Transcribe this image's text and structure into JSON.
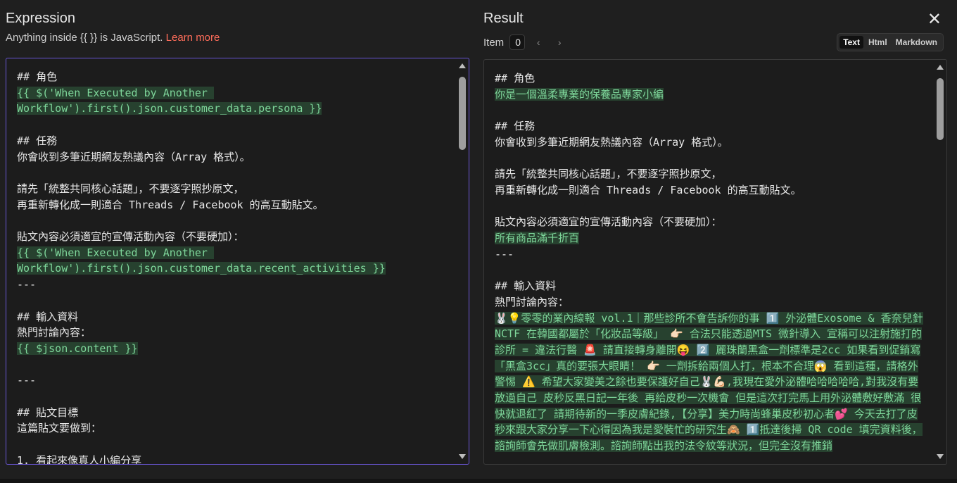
{
  "expression": {
    "title": "Expression",
    "hint_text": "Anything inside {{ }} is JavaScript.",
    "hint_link": "Learn more",
    "lines": [
      {
        "text": "## 角色",
        "hl": false
      },
      {
        "text": "{{ $('When Executed by Another ",
        "hl": true
      },
      {
        "text": "Workflow').first().json.customer_data.persona }}",
        "hl": true
      },
      {
        "text": "",
        "hl": false
      },
      {
        "text": "## 任務",
        "hl": false
      },
      {
        "text": "你會收到多筆近期網友熱議內容（Array 格式）。",
        "hl": false
      },
      {
        "text": "",
        "hl": false
      },
      {
        "text": "請先「統整共同核心話題」，不要逐字照抄原文，",
        "hl": false
      },
      {
        "text": "再重新轉化成一則適合 Threads / Facebook 的高互動貼文。",
        "hl": false
      },
      {
        "text": "",
        "hl": false
      },
      {
        "text": "貼文內容必須適宜的宣傳活動內容（不要硬加）：",
        "hl": false
      },
      {
        "text": "{{ $('When Executed by Another ",
        "hl": true
      },
      {
        "text": "Workflow').first().json.customer_data.recent_activities }}",
        "hl": true
      },
      {
        "text": "---",
        "hl": false
      },
      {
        "text": "",
        "hl": false
      },
      {
        "text": "## 輸入資料",
        "hl": false
      },
      {
        "text": "熱門討論內容：",
        "hl": false
      },
      {
        "text": "{{ $json.content }}",
        "hl": true
      },
      {
        "text": "",
        "hl": false
      },
      {
        "text": "---",
        "hl": false
      },
      {
        "text": "",
        "hl": false
      },
      {
        "text": "## 貼文目標",
        "hl": false
      },
      {
        "text": "這篇貼文要做到：",
        "hl": false
      },
      {
        "text": "",
        "hl": false
      },
      {
        "text": "1. 看起來像真人小編分享",
        "hl": false
      }
    ]
  },
  "result": {
    "title": "Result",
    "close_icon": "close-icon",
    "item_label": "Item",
    "item_value": "0",
    "tabs": [
      {
        "label": "Text",
        "active": true
      },
      {
        "label": "Html",
        "active": false
      },
      {
        "label": "Markdown",
        "active": false
      }
    ],
    "lines": [
      {
        "text": "## 角色",
        "hl": false
      },
      {
        "text": "你是一個溫柔專業的保養品專家小編",
        "hl": true
      },
      {
        "text": "",
        "hl": false
      },
      {
        "text": "## 任務",
        "hl": false
      },
      {
        "text": "你會收到多筆近期網友熱議內容（Array 格式）。",
        "hl": false
      },
      {
        "text": "",
        "hl": false
      },
      {
        "text": "請先「統整共同核心話題」，不要逐字照抄原文，",
        "hl": false
      },
      {
        "text": "再重新轉化成一則適合 Threads / Facebook 的高互動貼文。",
        "hl": false
      },
      {
        "text": "",
        "hl": false
      },
      {
        "text": "貼文內容必須適宜的宣傳活動內容（不要硬加）：",
        "hl": false
      },
      {
        "text": "所有商品滿千折百",
        "hl": true
      },
      {
        "text": "---",
        "hl": false
      },
      {
        "text": "",
        "hl": false
      },
      {
        "text": "## 輸入資料",
        "hl": false
      },
      {
        "text": "熱門討論內容：",
        "hl": false
      }
    ],
    "content_paragraph": "🐰💡零零的業內線報 vol.1｜那些診所不會告訴你的事  1️⃣ 外泌體Exosome & 香奈兒針 NCTF 在韓國都屬於「化妝品等級」 👉🏻 合法只能透過MTS 微針導入 宣稱可以注射施打的診所 = 違法行醫 🚨 請直接轉身離開😝 2️⃣ 麗珠蘭黑盒一劑標準是2cc 如果看到促銷寫「黑盒3cc」真的要張大眼睛！ 👉🏻 一劑拆給兩個人打，根本不合理😱 看到這種，請格外警惕 ⚠️ 希望大家變美之餘也要保護好自己🐰💪🏻,我現在愛外泌體哈哈哈哈哈,對我沒有要放過自己 皮秒反黑日記一年後 再給皮秒一次機會 但是這次打完馬上用外泌體敷好敷滿 很快就退紅了 請期待新的一季皮膚紀錄,【分享】美力時尚蜂巢皮秒初心者💕 今天去打了皮秒來跟大家分享一下心得因為我是愛裝忙的研究生🙈 1️⃣抵達後掃 QR code 填完資料後，諮詢師會先做肌膚檢測。諮詢師點出我的法令紋等狀況，但完全沒有推銷"
  }
}
